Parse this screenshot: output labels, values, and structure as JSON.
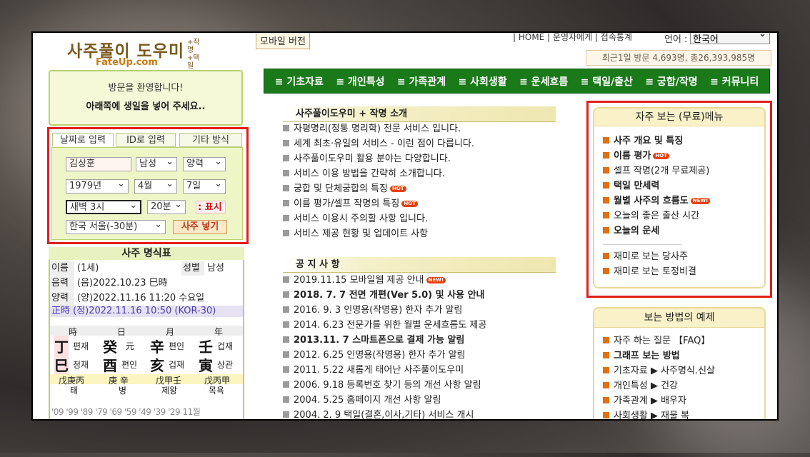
{
  "header": {
    "logo_main": "사주풀이 도우미",
    "logo_sub1": "+작명",
    "logo_sub2": "+택일",
    "logo_url": "FateUp.com",
    "mobile_version": "모바일 버전",
    "top_links": "| HOME  | 운영자에게  | 접속통계",
    "language_label": "언어 :",
    "language_value": "한국어",
    "visit_stats": "최근1일 방문 4,693명, 총26,393,985명"
  },
  "nav": {
    "items": [
      "≡ 기초자료",
      "≡ 개인특성",
      "≡ 가족관계",
      "≡ 사회생활",
      "≡ 운세흐름",
      "≡ 택일/출산",
      "≡ 궁합/작명",
      "≡ 커뮤니티"
    ]
  },
  "welcome": {
    "line1": "방문을 환영합니다!",
    "line2": "아래쪽에 생일을 넣어 주세요.."
  },
  "input": {
    "tabs": [
      "날짜로 입력",
      "ID로 입력",
      "기타 방식"
    ],
    "name": "김상훈",
    "gender": "남성",
    "calendar": "양력",
    "year": "1979년",
    "month": "4월",
    "day": "7일",
    "hour": "새벽 3시",
    "minute": "20분",
    "display_btn": ": 표시",
    "location": "한국 서울(-30분)",
    "submit_btn": "사주 넣기"
  },
  "saju": {
    "title": "사주 명식표",
    "name_label": "이름",
    "name_value": "(1세)",
    "gender_label": "성별",
    "gender_value": "남성",
    "lunar_label": "음력",
    "lunar_value": "(음)2022.10.23 巳時",
    "solar_label": "양력",
    "solar_value": "(양)2022.11.16 11:20 수요일",
    "true_time": "正時 (정)2022.11.16 10:50 (KOR-30)",
    "pillar_heads": [
      "時",
      "日",
      "月",
      "年"
    ],
    "stems": [
      "丁",
      "癸",
      "辛",
      "壬"
    ],
    "stem_gods": [
      "편재",
      "元",
      "편인",
      "겁재"
    ],
    "branches": [
      "巳",
      "酉",
      "亥",
      "寅"
    ],
    "branch_gods": [
      "정재",
      "편인",
      "겁재",
      "상관"
    ],
    "hidden": [
      "戊庚丙",
      "庚 辛",
      "戊甲壬",
      "戊丙甲"
    ],
    "stages": [
      "태",
      "병",
      "제왕",
      "목욕"
    ],
    "daeun": "'09 '99 '89 '79 '69 '59 '49 '39 '29 11월"
  },
  "intro": {
    "title": "사주풀이도우미 + 작명 소개",
    "items": [
      "자평명리(정통 명리학) 전문 서비스 입니다.",
      "세계 최초·유일의 서비스 - 이런 점이 다릅니다.",
      "사주풀이도우미 활용 분야는 다양합니다.",
      "서비스 이용 방법을 간략히 소개합니다.",
      "궁합 및 단체궁합의 특징",
      "이름 평가/셀프 작명의 특징",
      "서비스 이용시 주의할 사항 입니다.",
      "서비스 제공 현황 및 업데이트 사항"
    ],
    "hot": "HOT"
  },
  "notice": {
    "title": "공 지 사 항",
    "items": [
      "2019.11.15 모바일웹 제공 안내",
      "2018. 7. 7 전면 개편(Ver 5.0) 및 사용 안내",
      "2016. 9. 3 인명용(작명용) 한자 추가 알림",
      "2014. 6.23 전문가를 위한 월별 운세흐름도 제공",
      "2013.11. 7 스마트폰으로 결제 가능 알림",
      "2012. 6.25 인명용(작명용) 한자 추가 알림",
      "2011. 5.22 새롭게 태어난 사주풀이도우미",
      "2006. 9.18 등록번호 찾기 등의 개선 사항 알림",
      "2004. 5.25 홈페이지 개선 사항 알림",
      "2004. 2. 9 택일(결혼,이사,기타) 서비스 개시"
    ],
    "new": "NEW!"
  },
  "free_menu": {
    "title": "자주 보는 (무료)메뉴",
    "items": [
      "사주 개요 및 특징",
      "이름 평가",
      "셀프 작명(2개 무료제공)",
      "택일 만세력",
      "월별 사주의 흐름도",
      "오늘의 좋은 출산 시간",
      "오늘의 운세"
    ],
    "items2": [
      "재미로 보는 당사주",
      "재미로 보는 토정비결"
    ]
  },
  "examples": {
    "title": "보는 방법의 예제",
    "items": [
      "자주 하는 질문 【FAQ】",
      "그래프 보는 방법",
      "기초자료 ▶ 사주명식.신살",
      "개인특성 ▶ 건강",
      "가족관계 ▶ 배우자",
      "사회생활 ▶ 재물 복"
    ]
  }
}
